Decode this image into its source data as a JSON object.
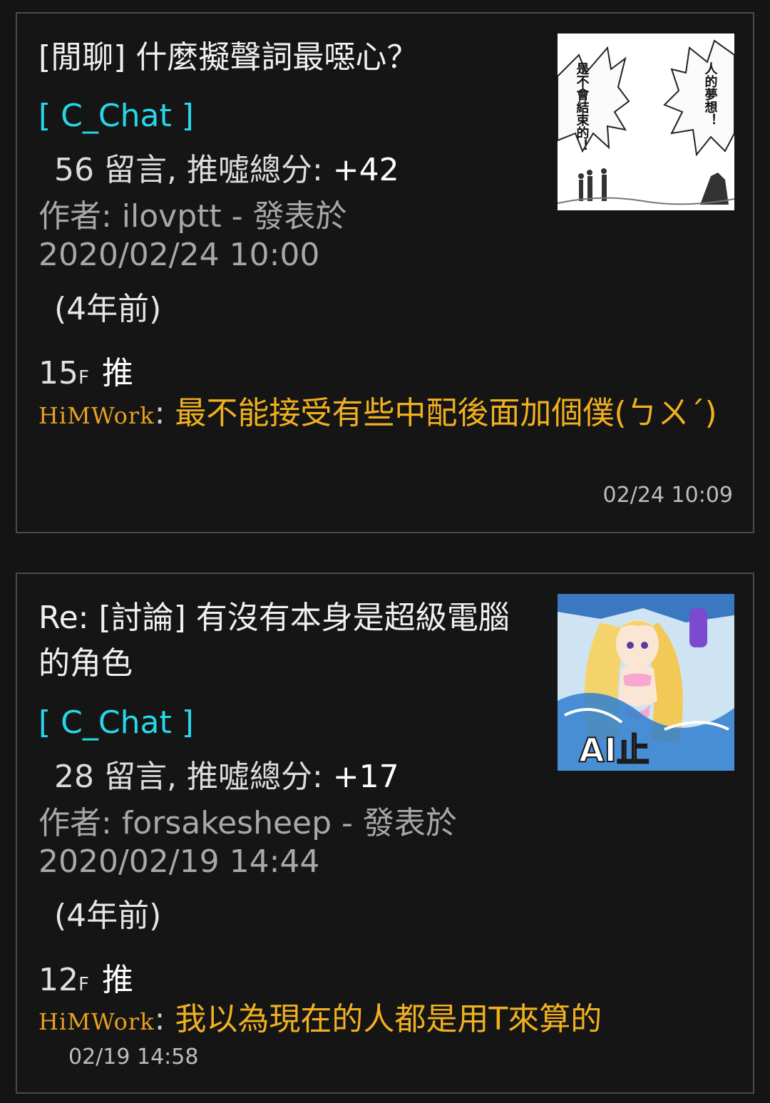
{
  "posts": [
    {
      "title": "[閒聊] 什麼擬聲詞最噁心？",
      "board": "[ C_Chat ]",
      "stats_prefix": "56 留言, 推噓總分: ",
      "score": "+42",
      "author_line": "作者: ilovptt - 發表於",
      "date": "2020/02/24 10:00",
      "ago": "(4年前)",
      "floor_number": "15",
      "floor_suffix": "F",
      "push_tag": "推",
      "commenter": "HiMWork",
      "comment": "最不能接受有些中配後面加個僕(ㄅㄨˊ)",
      "comment_time": "02/24 10:09",
      "thumb_text_left": "是不會結束的！",
      "thumb_text_right": "人的夢想！"
    },
    {
      "title": "Re: [討論] 有沒有本身是超級電腦的角色",
      "board": "[ C_Chat ]",
      "stats_prefix": "28 留言, 推噓總分: ",
      "score": "+17",
      "author_line": "作者: forsakesheep - 發表於",
      "date": "2020/02/19 14:44",
      "ago": "(4年前)",
      "floor_number": "12",
      "floor_suffix": "F",
      "push_tag": "推",
      "commenter": "HiMWork",
      "comment": "我以為現在的人都是用T來算的",
      "comment_time": "02/19 14:58",
      "thumb_text": "AI止"
    }
  ],
  "colors": {
    "background": "#141414",
    "board": "#27d7ea",
    "comment": "#f0b020",
    "border": "#4a4a4a"
  }
}
